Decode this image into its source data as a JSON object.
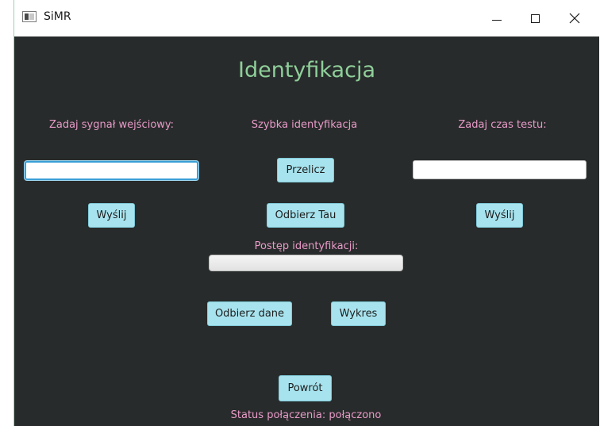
{
  "window": {
    "title": "SiMR",
    "icon": "app-window-icon"
  },
  "main": {
    "heading": "Identyfikacja",
    "input_signal": {
      "label": "Zadaj sygnał wejściowy:",
      "value": "",
      "send_label": "Wyślij"
    },
    "quick_identification": {
      "label": "Szybka identyfikacja",
      "compute_label": "Przelicz",
      "receive_tau_label": "Odbierz Tau"
    },
    "test_time": {
      "label": "Zadaj czas testu:",
      "value": "",
      "send_label": "Wyślij"
    },
    "progress": {
      "label": "Postęp identyfikacji:",
      "value": 0
    },
    "receive_data_label": "Odbierz dane",
    "chart_label": "Wykres",
    "back_label": "Powrót",
    "status": "Status połączenia: połączono"
  },
  "colors": {
    "background": "#282b2b",
    "heading": "#8fcf9a",
    "label": "#e89bc8",
    "button": "#a7e3ee"
  }
}
